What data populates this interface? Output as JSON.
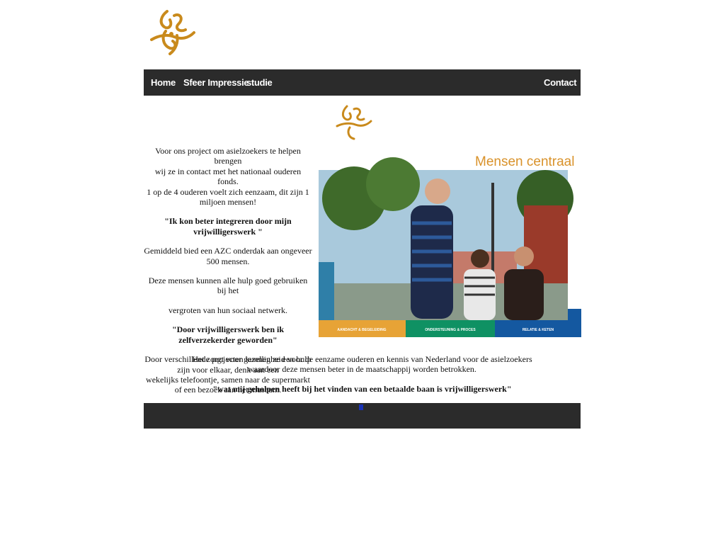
{
  "nav": {
    "home": "Home",
    "sfeer": "Sfeer Impressie",
    "studie": "studie",
    "contact": "Contact"
  },
  "content": {
    "p1_l1": "Voor ons project om asielzoekers te helpen brengen",
    "p1_l2": "wij ze in contact met het nationaal ouderen fonds.",
    "p1_l3": "1 op de 4 ouderen voelt zich eenzaam, dit zijn 1 miljoen mensen!",
    "quote1": "\"Ik kon beter integreren door mijn vrijwilligerswerk \"",
    "p2": "Gemiddeld bied een AZC onderdak aan ongeveer 500 mensen.",
    "p3": "Deze mensen kunnen alle hulp goed gebruiken bij het",
    "p4": "vergroten van hun sociaal netwerk.",
    "quote2": "\"Door vrijwilligerswerk ben ik zelfverzekerder geworden\"",
    "p5_l1": "Door verschillende projecten kunnen ze een hulp zijn voor elkaar, denk aan een",
    "p5_l2": "wekelijks telefoontje, samen naar de supermarkt of een bezoek aan het museum.",
    "p6_l1": "Het zorgt voor gezelligheid voor de eenzame ouderen en kennis van Nederland voor de asielzoekers",
    "p6_l2": "waardoor deze mensen beter in de maatschappij worden betrokken.",
    "quote3": "\"wat mij geholpen heeft bij het vinden van een betaalde baan is vrijwilligerswerk\""
  },
  "hero": {
    "heading": "Mensen centraal",
    "band1": "AANDACHT & BEGELEIDING",
    "band2": "ONDERSTEUNING & PROCES",
    "band3": "RELATIE & KETEN"
  },
  "colors": {
    "nav_bg": "#2b2b2b",
    "gold": "#c98a1c",
    "orange_band": "#e7a336",
    "green_band": "#0f9163",
    "blue_band": "#1458a0"
  }
}
